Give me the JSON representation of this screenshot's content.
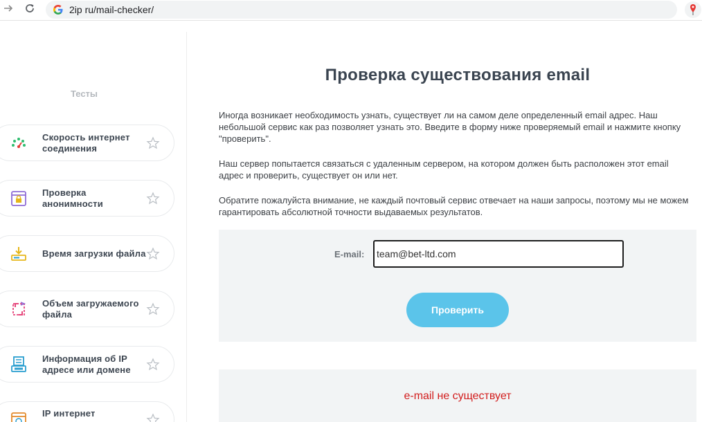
{
  "browser": {
    "url": "2ip ru/mail-checker/",
    "back_icon": "arrow-right-icon",
    "reload_icon": "reload-icon"
  },
  "sidebar": {
    "title": "Тесты",
    "items": [
      {
        "label": "Скорость интернет соединения",
        "icon": "speedometer-icon",
        "color": "#2ebd6e"
      },
      {
        "label": "Проверка анонимности",
        "icon": "anonymity-window-icon",
        "color": "#8e6bd6"
      },
      {
        "label": "Время загрузки файла",
        "icon": "download-icon",
        "color": "#e6b619"
      },
      {
        "label": "Объем загружаемого файла",
        "icon": "file-size-icon",
        "color": "#e6447a"
      },
      {
        "label": "Информация об IP адресе или домене",
        "icon": "ip-info-icon",
        "color": "#2a9ecf"
      },
      {
        "label": "IP интернет",
        "icon": "ip-internet-icon",
        "color": "#e38a2b"
      }
    ]
  },
  "main": {
    "title": "Проверка существования email",
    "paragraphs": [
      "Иногда возникает необходимость узнать, существует ли на самом деле определенный email адрес. Наш небольшой сервис как раз позволяет узнать это. Введите в форму ниже проверяемый email и нажмите кнопку \"проверить\".",
      "Наш сервер попытается связаться с удаленным сервером, на котором должен быть расположен этот email адрес и проверить, существует он или нет.",
      "Обратите пожалуйста внимание, не каждый почтовый сервис отвечает на наши запросы, поэтому мы не можем гарантировать абсолютной точности выдаваемых результатов."
    ],
    "form": {
      "email_label": "E-mail:",
      "email_value": "team@bet-ltd.com",
      "submit_label": "Проверить"
    },
    "result": "e-mail не существует"
  },
  "colors": {
    "accent": "#5bc4ea",
    "error": "#d21c1c"
  }
}
